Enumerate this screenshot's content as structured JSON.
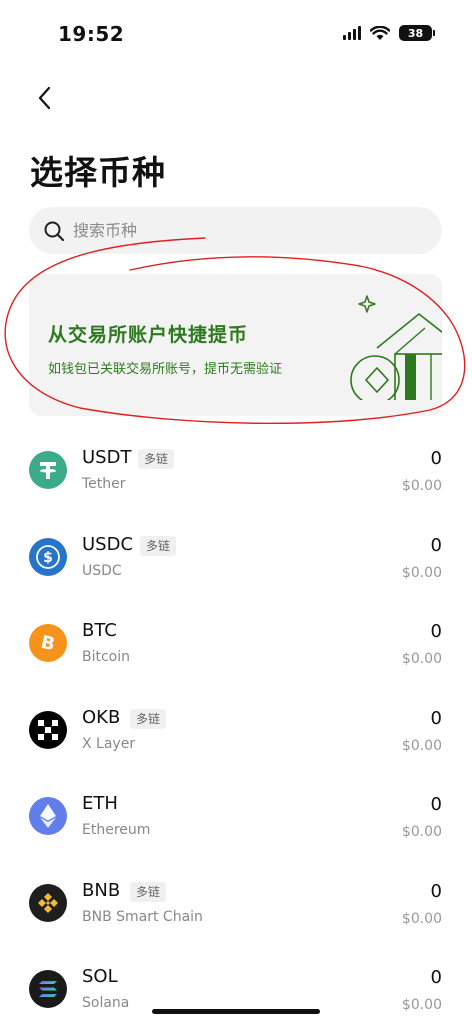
{
  "status_bar": {
    "time": "19:52",
    "battery": "38"
  },
  "page": {
    "title": "选择币种"
  },
  "search": {
    "placeholder": "搜索币种"
  },
  "banner": {
    "title": "从交易所账户快捷提币",
    "subtitle": "如钱包已关联交易所账号，提币无需验证",
    "accent_color": "#2d7a1e"
  },
  "tokens": [
    {
      "symbol": "USDT",
      "badge": "多链",
      "name": "Tether",
      "amount": "0",
      "value": "$0.00",
      "icon": "tether-icon",
      "color": "#3bab8a"
    },
    {
      "symbol": "USDC",
      "badge": "多链",
      "name": "USDC",
      "amount": "0",
      "value": "$0.00",
      "icon": "usdc-icon",
      "color": "#2775ca"
    },
    {
      "symbol": "BTC",
      "badge": "",
      "name": "Bitcoin",
      "amount": "0",
      "value": "$0.00",
      "icon": "bitcoin-icon",
      "color": "#f7931a"
    },
    {
      "symbol": "OKB",
      "badge": "多链",
      "name": "X Layer",
      "amount": "0",
      "value": "$0.00",
      "icon": "okb-icon",
      "color": "#000000"
    },
    {
      "symbol": "ETH",
      "badge": "",
      "name": "Ethereum",
      "amount": "0",
      "value": "$0.00",
      "icon": "ethereum-icon",
      "color": "#627eea"
    },
    {
      "symbol": "BNB",
      "badge": "多链",
      "name": "BNB Smart Chain",
      "amount": "0",
      "value": "$0.00",
      "icon": "bnb-icon",
      "color": "#f3ba2f"
    },
    {
      "symbol": "SOL",
      "badge": "",
      "name": "Solana",
      "amount": "0",
      "value": "$0.00",
      "icon": "solana-icon",
      "color": "#1a1a1a"
    }
  ]
}
